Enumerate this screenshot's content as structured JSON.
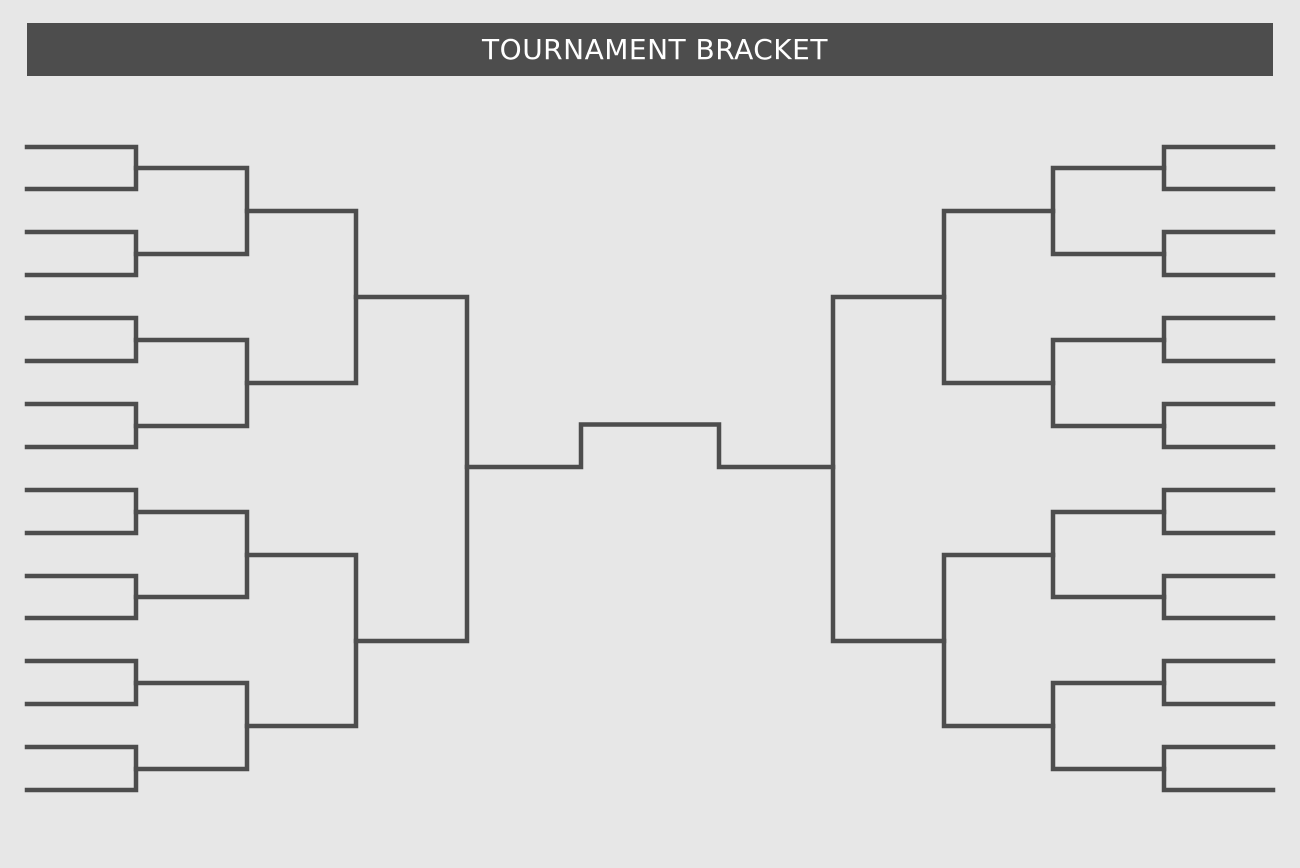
{
  "header": {
    "title": "TOURNAMENT BRACKET",
    "background_color": "#4d4d4d",
    "text_color": "#ffffff"
  },
  "bracket": {
    "rounds_per_side": 4,
    "entrants_per_side": 16,
    "sides": [
      "left",
      "right"
    ],
    "line_color": "#4d4d4d",
    "background_color": "#e7e7e7"
  }
}
